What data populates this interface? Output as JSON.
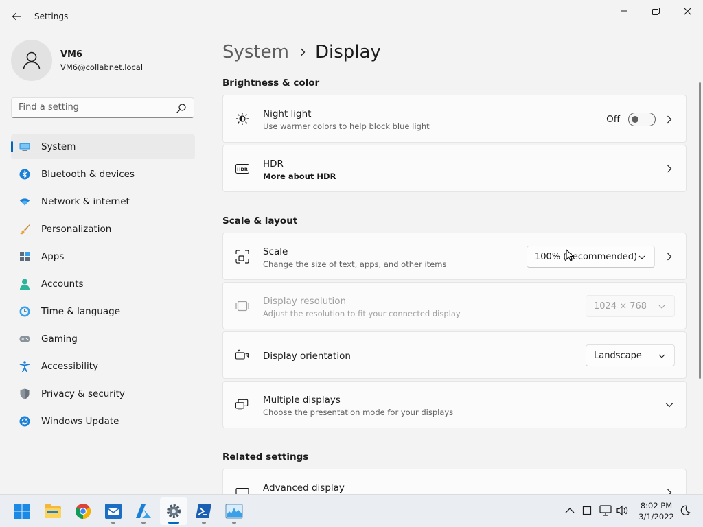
{
  "window": {
    "title": "Settings"
  },
  "profile": {
    "name": "VM6",
    "email": "VM6@collabnet.local"
  },
  "search": {
    "placeholder": "Find a setting"
  },
  "sidebar": {
    "items": [
      {
        "label": "System",
        "icon": "monitor-icon",
        "active": true
      },
      {
        "label": "Bluetooth & devices",
        "icon": "bluetooth-icon"
      },
      {
        "label": "Network & internet",
        "icon": "wifi-icon"
      },
      {
        "label": "Personalization",
        "icon": "brush-icon"
      },
      {
        "label": "Apps",
        "icon": "apps-icon"
      },
      {
        "label": "Accounts",
        "icon": "person-icon"
      },
      {
        "label": "Time & language",
        "icon": "clock-globe-icon"
      },
      {
        "label": "Gaming",
        "icon": "gamepad-icon"
      },
      {
        "label": "Accessibility",
        "icon": "accessibility-icon"
      },
      {
        "label": "Privacy & security",
        "icon": "shield-icon"
      },
      {
        "label": "Windows Update",
        "icon": "update-icon"
      }
    ]
  },
  "breadcrumb": {
    "parent": "System",
    "current": "Display"
  },
  "sections": {
    "brightness": "Brightness & color",
    "scale_layout": "Scale & layout",
    "related": "Related settings"
  },
  "cards": {
    "night_light": {
      "title": "Night light",
      "subtitle": "Use warmer colors to help block blue light",
      "toggle_text": "Off",
      "on": false
    },
    "hdr": {
      "title": "HDR",
      "subtitle": "More about HDR"
    },
    "scale": {
      "title": "Scale",
      "subtitle": "Change the size of text, apps, and other items",
      "value": "100% (Recommended)"
    },
    "resolution": {
      "title": "Display resolution",
      "subtitle": "Adjust the resolution to fit your connected display",
      "value": "1024 × 768",
      "disabled": true
    },
    "orientation": {
      "title": "Display orientation",
      "value": "Landscape"
    },
    "multiple": {
      "title": "Multiple displays",
      "subtitle": "Choose the presentation mode for your displays"
    },
    "advanced": {
      "title": "Advanced display"
    }
  },
  "taskbar": {
    "time": "8:02 PM",
    "date": "3/1/2022"
  },
  "colors": {
    "accent": "#0067c0",
    "background": "#f3f3f3",
    "card": "#fbfbfb"
  }
}
